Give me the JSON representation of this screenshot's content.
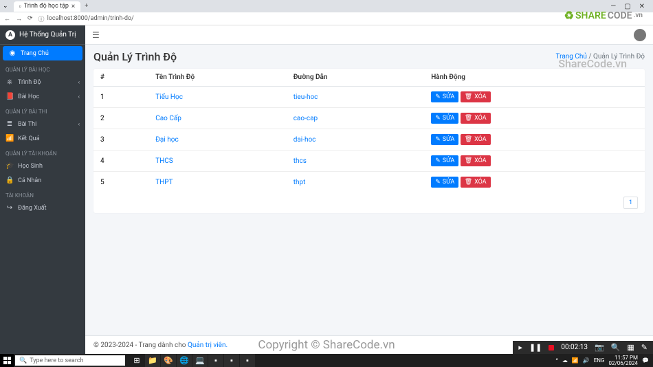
{
  "browser": {
    "tab_title": "Trình độ học tập",
    "url": "localhost:8000/admin/trinh-do/"
  },
  "brand": "Hệ Thống Quản Trị",
  "sidebar": {
    "home": "Trang Chủ",
    "sections": [
      {
        "header": "QUẢN LÝ BÀI HỌC",
        "items": [
          {
            "icon": "⎈",
            "label": "Trình Độ",
            "expandable": true
          },
          {
            "icon": "📕",
            "label": "Bài Học",
            "expandable": true
          }
        ]
      },
      {
        "header": "QUẢN LÝ BÀI THI",
        "items": [
          {
            "icon": "≣",
            "label": "Bài Thi",
            "expandable": true
          },
          {
            "icon": "📶",
            "label": "Kết Quả",
            "expandable": false
          }
        ]
      },
      {
        "header": "QUẢN LÝ TÀI KHOẢN",
        "items": [
          {
            "icon": "🎓",
            "label": "Học Sinh",
            "expandable": false
          },
          {
            "icon": "🔒",
            "label": "Cá Nhân",
            "expandable": false
          }
        ]
      },
      {
        "header": "TÀI KHOẢN",
        "items": [
          {
            "icon": "↪",
            "label": "Đăng Xuất",
            "expandable": false
          }
        ]
      }
    ]
  },
  "page": {
    "title": "Quản Lý Trình Độ",
    "breadcrumb_home": "Trang Chủ",
    "breadcrumb_current": "Quản Lý Trình Độ"
  },
  "table": {
    "headers": {
      "idx": "#",
      "name": "Tên Trình Độ",
      "slug": "Đường Dẫn",
      "action": "Hành Động"
    },
    "edit_label": "SỬA",
    "delete_label": "XÓA",
    "rows": [
      {
        "idx": "1",
        "name": "Tiểu Học",
        "slug": "tieu-hoc"
      },
      {
        "idx": "2",
        "name": "Cao Cấp",
        "slug": "cao-cap"
      },
      {
        "idx": "3",
        "name": "Đại học",
        "slug": "dai-hoc"
      },
      {
        "idx": "4",
        "name": "THCS",
        "slug": "thcs"
      },
      {
        "idx": "5",
        "name": "THPT",
        "slug": "thpt"
      }
    ],
    "page_number": "1"
  },
  "footer": {
    "copyright": "© 2023-2024 - Trang dành cho ",
    "admin_link": "Quản trị viên."
  },
  "watermarks": {
    "sharecode": "ShareCode.vn",
    "center": "Copyright © ShareCode.vn",
    "logo_share": "SHARE",
    "logo_code": "CODE",
    "logo_tld": ".vn"
  },
  "recorder": {
    "time": "00:02:13"
  },
  "taskbar": {
    "search_placeholder": "Type here to search",
    "time": "11:57 PM",
    "date": "02/06/2024"
  }
}
